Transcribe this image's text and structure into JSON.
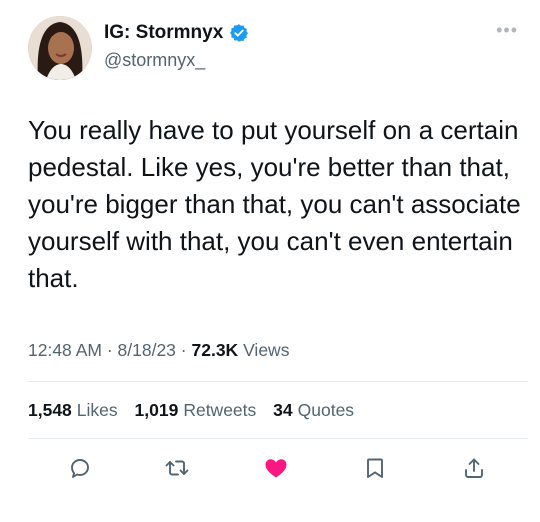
{
  "author": {
    "display_name": "IG: Stormnyx",
    "handle": "@stormnyx_",
    "verified_icon": "verified-badge-icon"
  },
  "tweet": {
    "text": "You really have to put yourself on a certain pedestal. Like yes, you're better than that, you're bigger than that, you can't associate yourself with that, you can't even entertain that."
  },
  "meta": {
    "time": "12:48 AM",
    "date": "8/18/23",
    "views_count": "72.3K",
    "views_label": "Views"
  },
  "stats": {
    "likes_count": "1,548",
    "likes_label": "Likes",
    "retweets_count": "1,019",
    "retweets_label": "Retweets",
    "quotes_count": "34",
    "quotes_label": "Quotes"
  },
  "colors": {
    "verified": "#1d9bf0",
    "like": "#f91880",
    "icon_gray": "#536471"
  }
}
